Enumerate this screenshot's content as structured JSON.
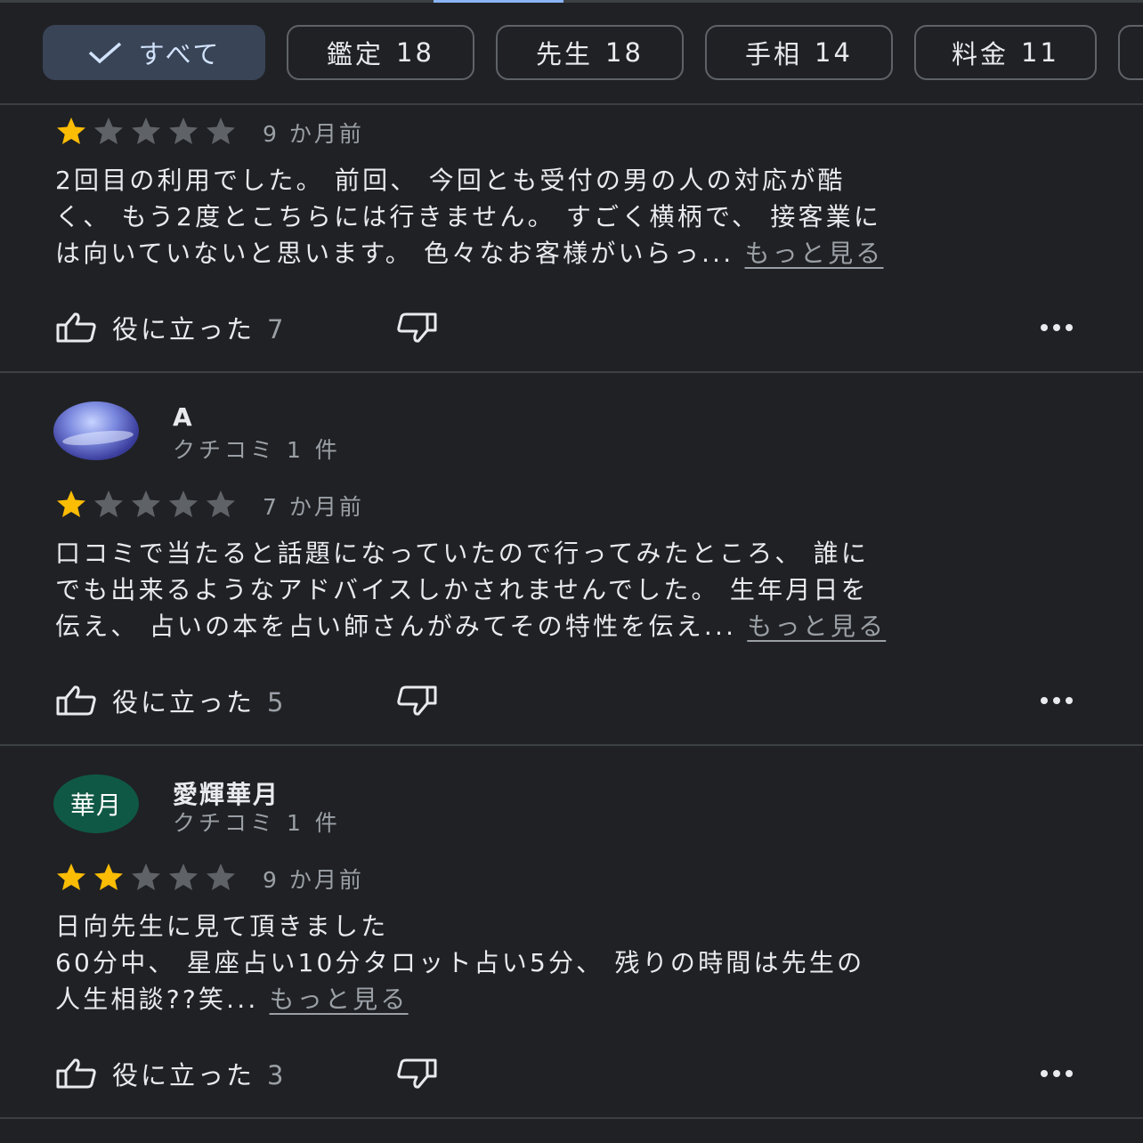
{
  "filters": [
    {
      "label": "すべて",
      "count": "",
      "selected": true
    },
    {
      "label": "鑑定",
      "count": "18",
      "selected": false
    },
    {
      "label": "先生",
      "count": "18",
      "selected": false
    },
    {
      "label": "手相",
      "count": "14",
      "selected": false
    },
    {
      "label": "料金",
      "count": "11",
      "selected": false
    }
  ],
  "colors": {
    "accent": "#8ab4f8",
    "star_on": "#fbbc04",
    "star_off": "#5f6368",
    "background": "#202124"
  },
  "reviews": [
    {
      "rating": 1,
      "date": "9 か月前",
      "lines": [
        "2回目の利用でした。 前回、 今回とも受付の男の人の対応が酷",
        "く、 もう2度とこちらには行きません。 すごく横柄で、 接客業に",
        "は向いていないと思います。 色々なお客様がいらっ..."
      ],
      "more": "もっと見る",
      "helpful_label": "役に立った",
      "helpful_count": "7"
    },
    {
      "reviewer": "A",
      "meta": "クチコミ 1 件",
      "avatar": "sky-photo",
      "rating": 1,
      "date": "7 か月前",
      "lines": [
        "口コミで当たると話題になっていたので行ってみたところ、 誰に",
        "でも出来るようなアドバイスしかされませんでした。 生年月日を",
        "伝え、 占いの本を占い師さんがみてその特性を伝え..."
      ],
      "more": "もっと見る",
      "helpful_label": "役に立った",
      "helpful_count": "5"
    },
    {
      "reviewer": "愛輝華月",
      "meta": "クチコミ 1 件",
      "avatar_text": "華月",
      "rating": 2,
      "date": "9 か月前",
      "lines": [
        "日向先生に見て頂きました",
        "60分中、 星座占い10分タロット占い5分、 残りの時間は先生の",
        "人生相談??笑..."
      ],
      "more": "もっと見る",
      "helpful_label": "役に立った",
      "helpful_count": "3"
    }
  ]
}
